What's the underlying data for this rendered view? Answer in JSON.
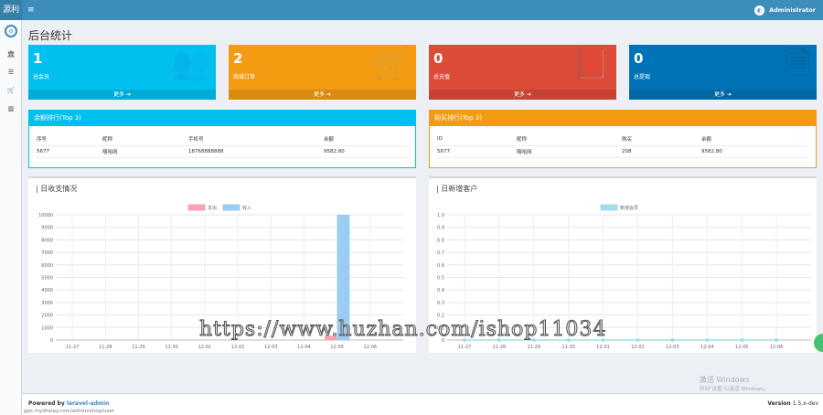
{
  "topbar": {
    "logo": "源利",
    "menu_icon": "≡",
    "user": "Administrator"
  },
  "sidebar": {
    "icons": [
      "bank-icon",
      "sliders-icon",
      "cart-icon",
      "chart-icon"
    ]
  },
  "page": {
    "title": "后台统计"
  },
  "cards": [
    {
      "value": "1",
      "label": "总会员",
      "more": "更多 ➔",
      "color": "#00c0ef",
      "icon": "users-icon"
    },
    {
      "value": "2",
      "label": "商城订单",
      "more": "更多 ➔",
      "color": "#f39c12",
      "icon": "cart-icon"
    },
    {
      "value": "0",
      "label": "总充值",
      "more": "更多 ➔",
      "color": "#dd4b39",
      "icon": "book-icon"
    },
    {
      "value": "0",
      "label": "总提现",
      "more": "更多 ➔",
      "color": "#0073b7",
      "icon": "file-icon"
    }
  ],
  "balance_rank": {
    "title": "余额排行(Top 3)",
    "headers": [
      "序号",
      "昵称",
      "手机号",
      "余额"
    ],
    "rows": [
      [
        "5677",
        "嘻哈网",
        "18768888888",
        "9582.80"
      ]
    ]
  },
  "purchase_rank": {
    "title": "购买排行(Top 3)",
    "headers": [
      "ID",
      "昵称",
      "购买",
      "余额"
    ],
    "rows": [
      [
        "5677",
        "嘻哈网",
        "208",
        "9582.80"
      ]
    ]
  },
  "chart1": {
    "title": "| 日收支情况"
  },
  "chart2": {
    "title": "| 日新增客户"
  },
  "chart_data": [
    {
      "type": "bar",
      "categories": [
        "11-27",
        "11-28",
        "11-29",
        "11-30",
        "12-01",
        "12-02",
        "12-03",
        "12-04",
        "12-05",
        "12-06"
      ],
      "series": [
        {
          "name": "支出",
          "values": [
            0,
            0,
            0,
            0,
            0,
            0,
            0,
            0,
            350,
            0
          ],
          "color": "#f7a3b5"
        },
        {
          "name": "收入",
          "values": [
            0,
            0,
            0,
            0,
            0,
            0,
            0,
            0,
            10000,
            0
          ],
          "color": "#9acdf1"
        }
      ],
      "ylim": [
        0,
        10000
      ],
      "yticks": [
        "0",
        "1000",
        "2000",
        "3000",
        "4000",
        "5000",
        "6000",
        "7000",
        "8000",
        "9000",
        "10000"
      ],
      "legend": "top-center",
      "grid": true
    },
    {
      "type": "line",
      "categories": [
        "11-27",
        "11-28",
        "11-29",
        "11-30",
        "12-01",
        "12-02",
        "12-03",
        "12-04",
        "12-05",
        "12-06"
      ],
      "series": [
        {
          "name": "新增会员",
          "values": [
            0,
            0,
            0,
            0,
            0,
            0,
            0,
            0,
            0,
            0
          ],
          "color": "#9fe0e6"
        }
      ],
      "ylim": [
        0,
        1.0
      ],
      "yticks": [
        "0",
        "0.1",
        "0.2",
        "0.3",
        "0.4",
        "0.5",
        "0.6",
        "0.7",
        "0.8",
        "0.9",
        "1.0"
      ],
      "legend": "top-center",
      "grid": true
    }
  ],
  "overlay": {
    "watermark": "https://www.huzhan.com/ishop11034",
    "win1": "激活 Windows",
    "win2": "转到\"设置\"以激活 Windows。"
  },
  "footer": {
    "powered_prefix": "Powered by",
    "powered_link": "laravel-admin",
    "version_label": "Version",
    "version": "1.5.x-dev",
    "status_url": "gps.mydhsiay.com/admin/shop/user"
  }
}
